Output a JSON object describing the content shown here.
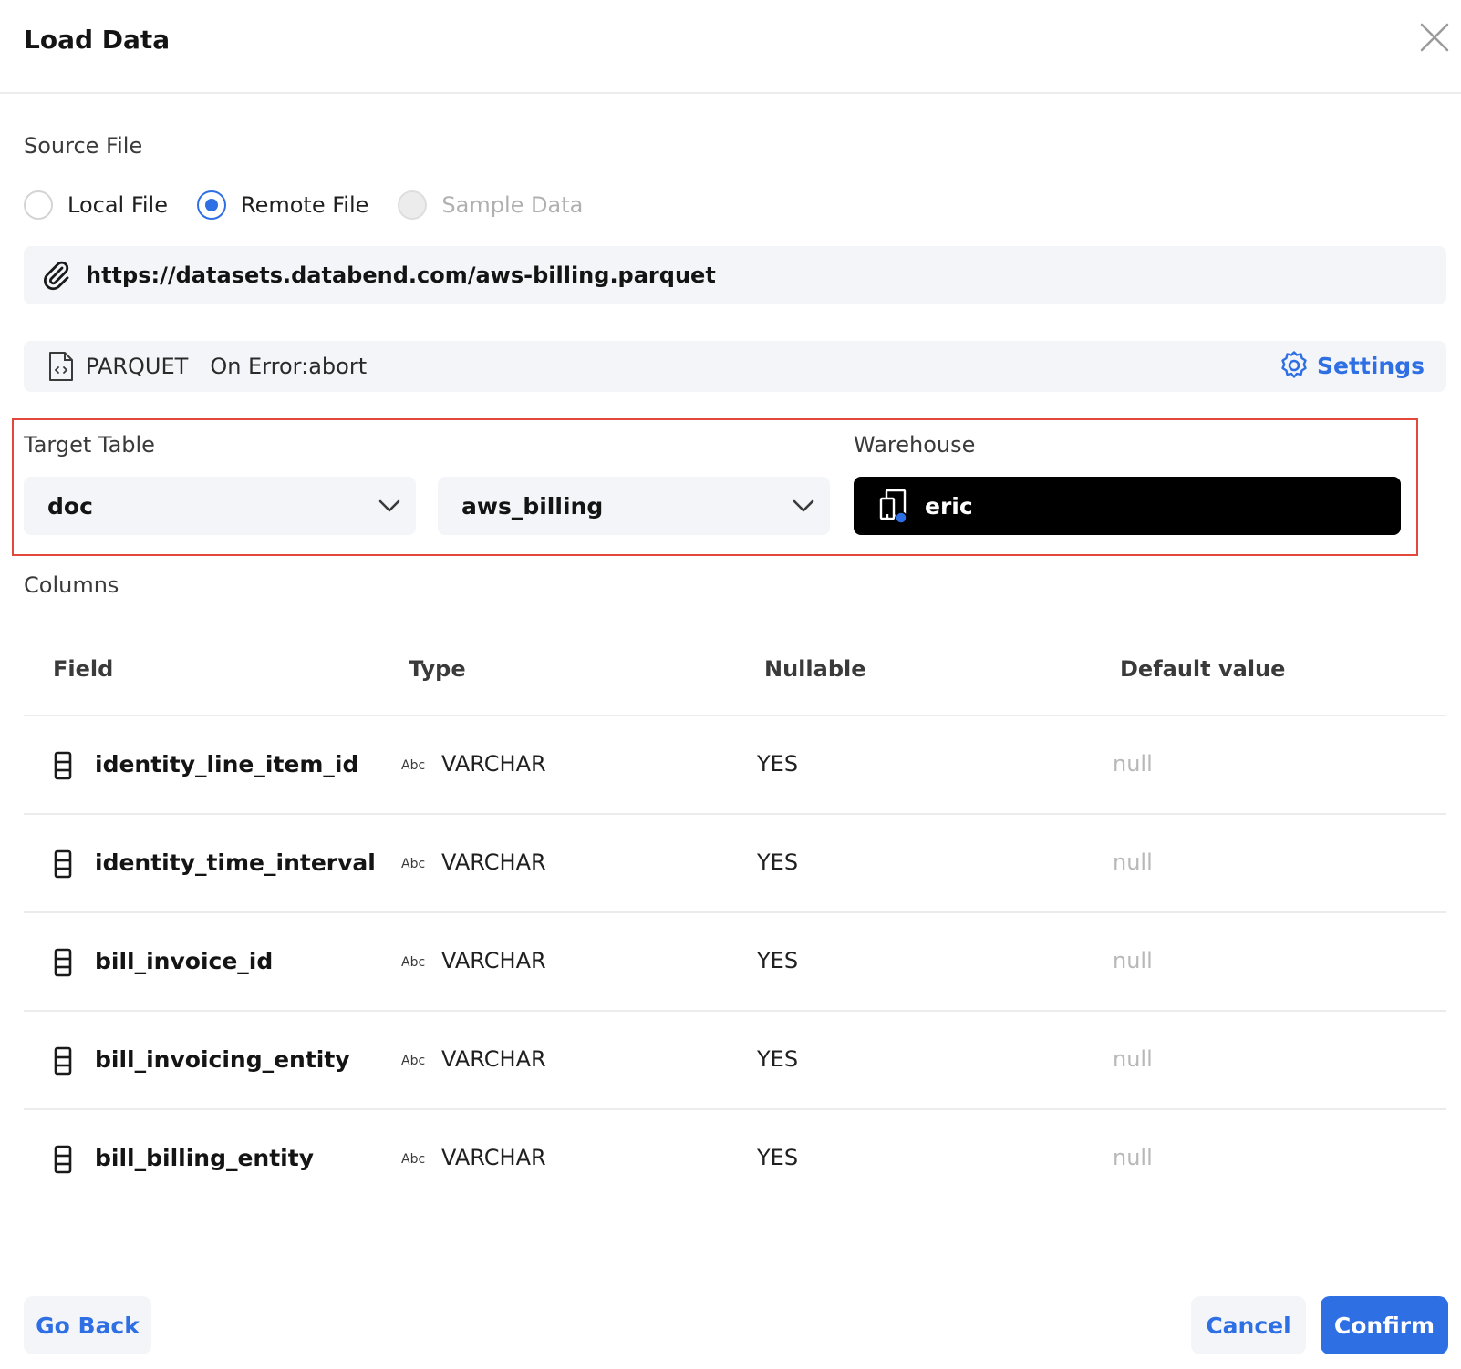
{
  "dialog": {
    "title": "Load Data"
  },
  "source": {
    "label": "Source File",
    "options": [
      {
        "label": "Local File",
        "state": "unchecked"
      },
      {
        "label": "Remote File",
        "state": "checked"
      },
      {
        "label": "Sample Data",
        "state": "disabled"
      }
    ],
    "url": "https://datasets.databend.com/aws-billing.parquet"
  },
  "format": {
    "type": "PARQUET",
    "on_error": "On Error:abort",
    "settings_label": "Settings"
  },
  "target": {
    "label": "Target Table",
    "database": "doc",
    "table": "aws_billing"
  },
  "warehouse": {
    "label": "Warehouse",
    "name": "eric"
  },
  "columns": {
    "label": "Columns",
    "headers": [
      "Field",
      "Type",
      "Nullable",
      "Default value"
    ],
    "type_badge": "Abc",
    "rows": [
      {
        "field": "identity_line_item_id",
        "type": "VARCHAR",
        "nullable": "YES",
        "default": "null"
      },
      {
        "field": "identity_time_interval",
        "type": "VARCHAR",
        "nullable": "YES",
        "default": "null"
      },
      {
        "field": "bill_invoice_id",
        "type": "VARCHAR",
        "nullable": "YES",
        "default": "null"
      },
      {
        "field": "bill_invoicing_entity",
        "type": "VARCHAR",
        "nullable": "YES",
        "default": "null"
      },
      {
        "field": "bill_billing_entity",
        "type": "VARCHAR",
        "nullable": "YES",
        "default": "null"
      }
    ]
  },
  "footer": {
    "back_label": "Go Back",
    "cancel_label": "Cancel",
    "confirm_label": "Confirm"
  },
  "colors": {
    "accent": "#2f6fe4",
    "highlight": "#e2483b",
    "warehouse_bg": "#000000",
    "panel_bg": "#f3f5f8"
  }
}
